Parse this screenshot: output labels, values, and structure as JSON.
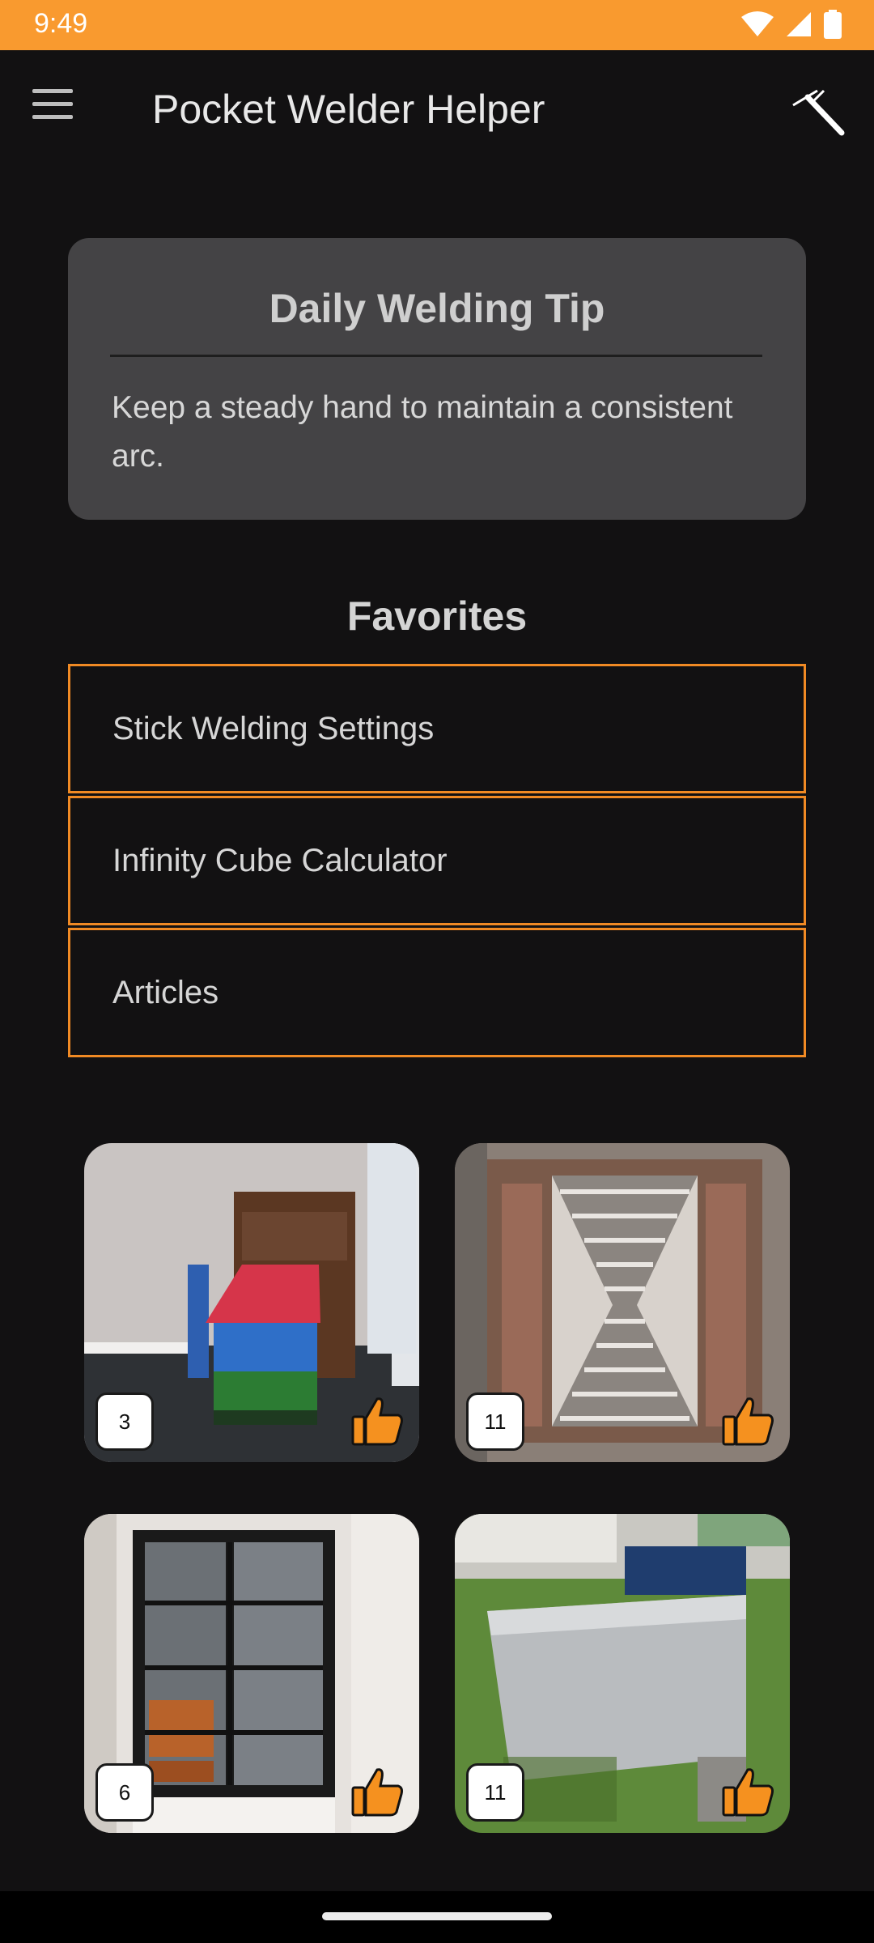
{
  "status_bar": {
    "time": "9:49",
    "icons": [
      "wifi-icon",
      "signal-icon",
      "battery-icon"
    ]
  },
  "app_bar": {
    "title": "Pocket Welder Helper",
    "menu_icon": "hamburger-menu-icon",
    "action_icon": "welding-torch-icon"
  },
  "tip_card": {
    "title": "Daily Welding Tip",
    "text": "Keep a steady hand to maintain a consistent arc."
  },
  "favorites": {
    "title": "Favorites",
    "items": [
      {
        "label": "Stick Welding Settings"
      },
      {
        "label": "Infinity Cube Calculator"
      },
      {
        "label": "Articles"
      }
    ]
  },
  "gallery": {
    "items": [
      {
        "likes": "3",
        "subject": "birdhouse"
      },
      {
        "likes": "11",
        "subject": "metal-art-panel"
      },
      {
        "likes": "6",
        "subject": "glass-cabinet"
      },
      {
        "likes": "11",
        "subject": "aluminum-tank"
      }
    ]
  },
  "colors": {
    "accent": "#f99a2f",
    "border": "#f08a24",
    "background": "#121112",
    "card": "#444345"
  }
}
